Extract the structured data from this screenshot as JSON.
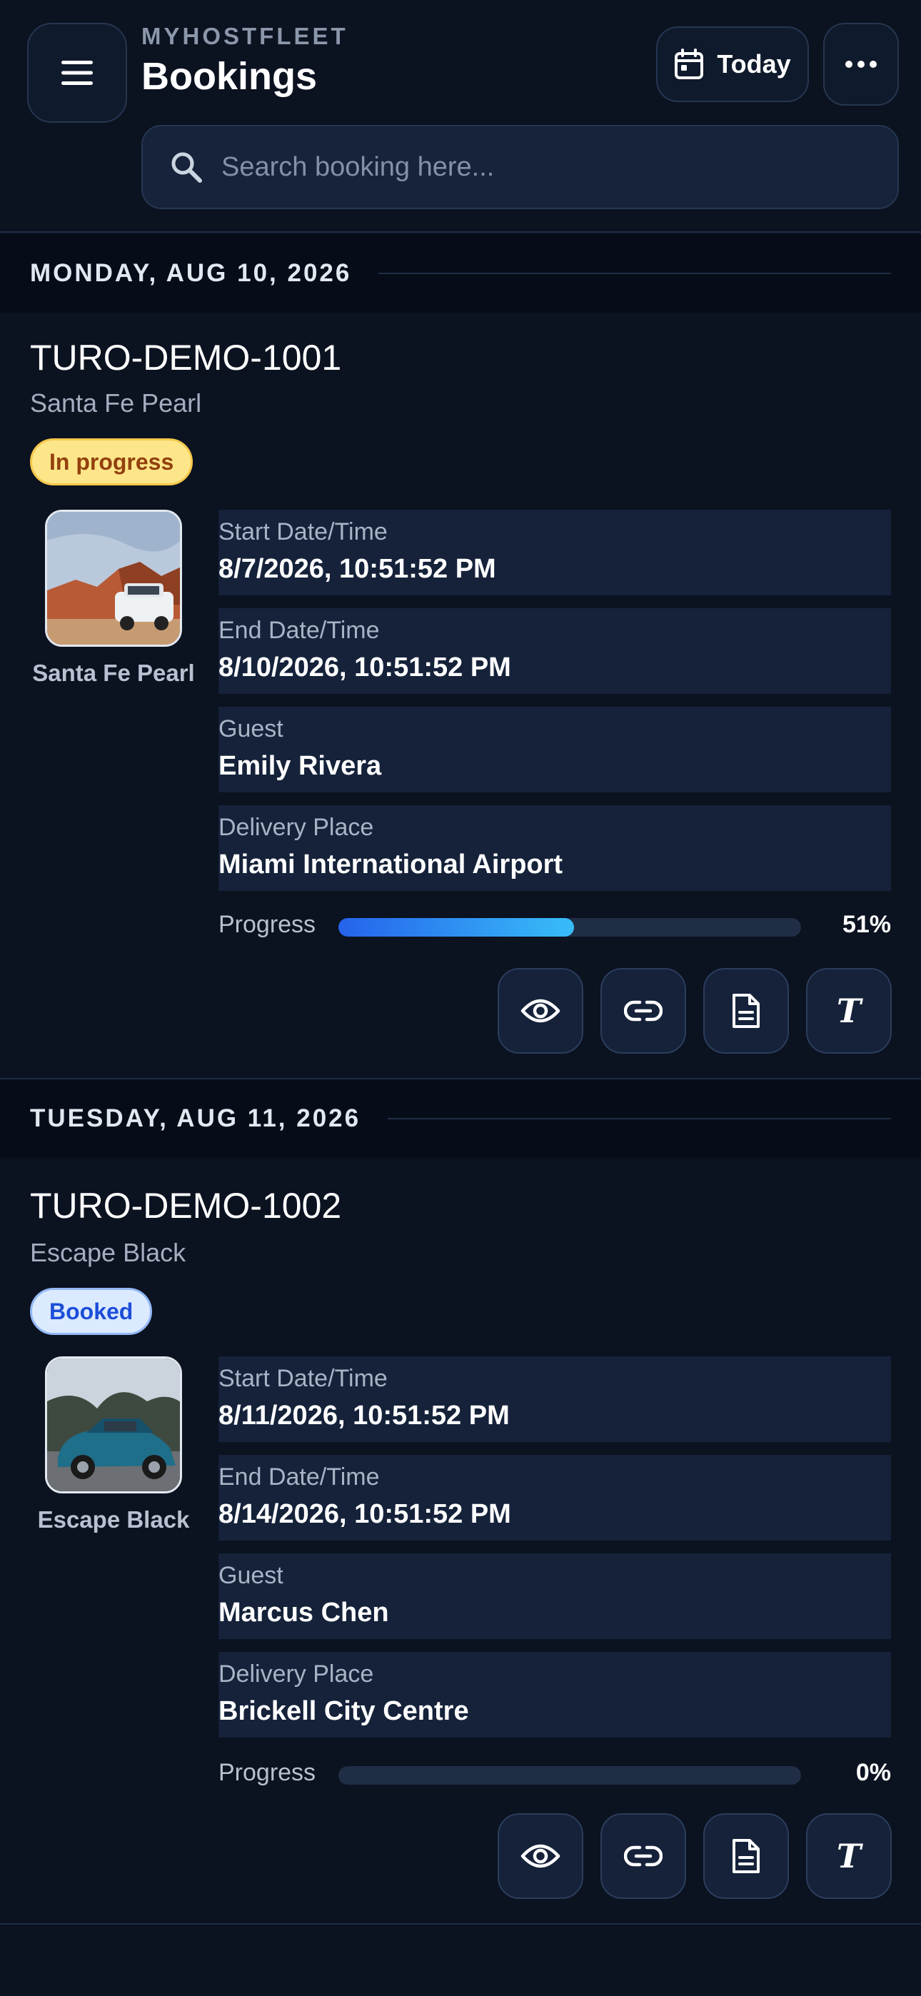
{
  "header": {
    "brand": "MYHOSTFLEET",
    "title": "Bookings",
    "today_label": "Today",
    "search_placeholder": "Search booking here..."
  },
  "groups": [
    {
      "date_label": "MONDAY, AUG 10, 2026",
      "booking": {
        "id": "TURO-DEMO-1001",
        "car": "Santa Fe Pearl",
        "status": "In progress",
        "thumb_label": "Santa Fe Pearl",
        "fields": [
          {
            "label": "Start Date/Time",
            "value": "8/7/2026, 10:51:52 PM"
          },
          {
            "label": "End Date/Time",
            "value": "8/10/2026, 10:51:52 PM"
          },
          {
            "label": "Guest",
            "value": "Emily Rivera"
          },
          {
            "label": "Delivery Place",
            "value": "Miami International Airport"
          }
        ],
        "progress_label": "Progress",
        "progress_value": 51,
        "progress_text": "51%"
      }
    },
    {
      "date_label": "TUESDAY, AUG 11, 2026",
      "booking": {
        "id": "TURO-DEMO-1002",
        "car": "Escape Black",
        "status": "Booked",
        "thumb_label": "Escape Black",
        "fields": [
          {
            "label": "Start Date/Time",
            "value": "8/11/2026, 10:51:52 PM"
          },
          {
            "label": "End Date/Time",
            "value": "8/14/2026, 10:51:52 PM"
          },
          {
            "label": "Guest",
            "value": "Marcus Chen"
          },
          {
            "label": "Delivery Place",
            "value": "Brickell City Centre"
          }
        ],
        "progress_label": "Progress",
        "progress_value": 0,
        "progress_text": "0%"
      }
    }
  ],
  "icons": {
    "menu": "hamburger-icon",
    "calendar": "calendar-icon",
    "more": "more-horizontal-icon",
    "search": "search-icon",
    "view": "eye-icon",
    "link": "link-icon",
    "document": "document-icon",
    "turo": "turo-t-icon"
  },
  "colors": {
    "background": "#0b1220",
    "card_field": "#15223a",
    "accent": "#2563eb",
    "status_in_progress": "#fde68a",
    "status_booked": "#dbeafe"
  }
}
